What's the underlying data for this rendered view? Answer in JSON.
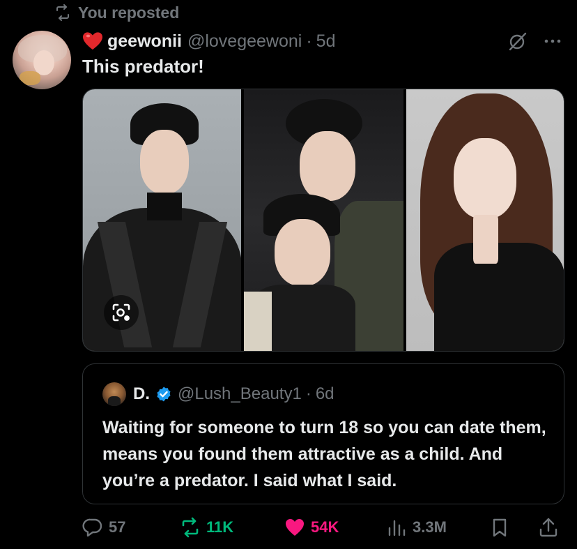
{
  "repost_banner": {
    "label": "You reposted"
  },
  "post": {
    "display_name": "geewonii",
    "handle": "@lovegeewoni",
    "separator": "·",
    "time": "5d",
    "text": "This predator!"
  },
  "quote": {
    "display_name": "D.",
    "handle": "@Lush_Beauty1",
    "separator": "·",
    "time": "6d",
    "text": "Waiting for someone to turn 18 so you can date them, means you found them attractive as a child. And you’re a predator. I said what I said."
  },
  "actions": {
    "replies": "57",
    "reposts": "11K",
    "likes": "54K",
    "views": "3.3M"
  },
  "colors": {
    "background": "#000000",
    "text": "#e7e9ea",
    "muted": "#71767b",
    "repost_green": "#00ba7c",
    "like_pink": "#f91880",
    "verified_blue": "#1d9bf0",
    "border": "#2f3336"
  },
  "icons": [
    "repost-icon",
    "heart-emoji-icon",
    "grok-icon",
    "more-icon",
    "image-search-icon",
    "verified-badge-icon",
    "reply-icon",
    "like-icon",
    "views-icon",
    "bookmark-icon",
    "share-icon"
  ]
}
